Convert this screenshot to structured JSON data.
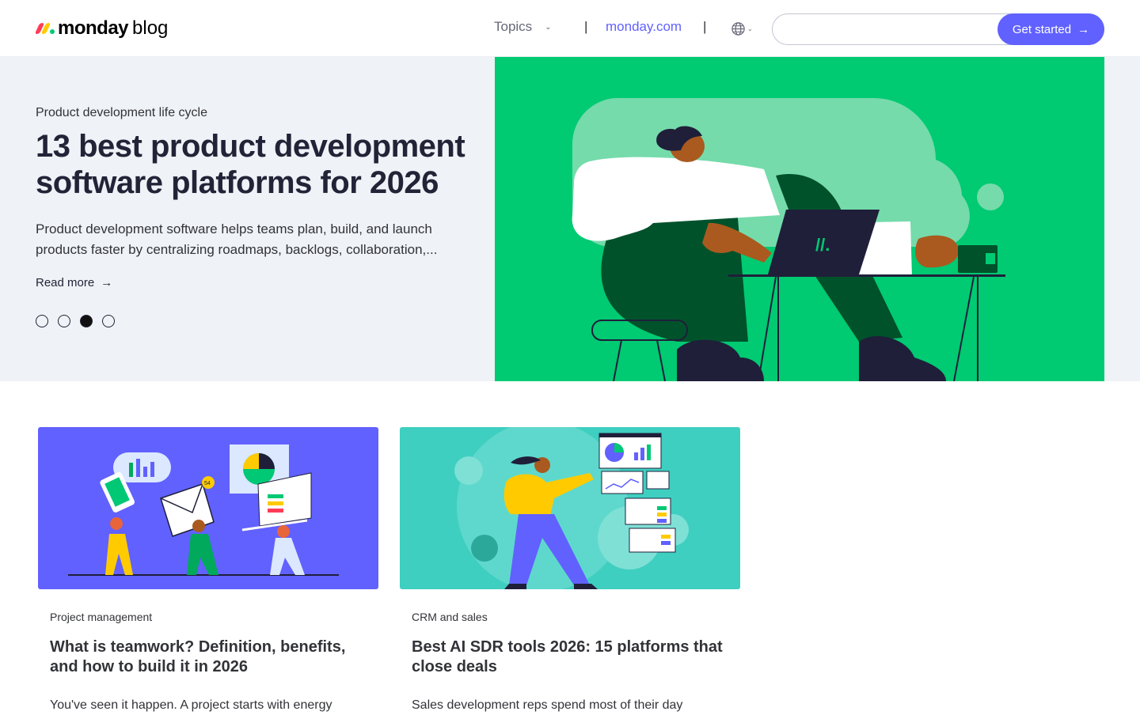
{
  "header": {
    "logo_word": "monday",
    "logo_suffix": "blog",
    "topics_label": "Topics",
    "separator": "|",
    "site_link": "monday.com",
    "search_placeholder": "",
    "cta_label": "Get started"
  },
  "hero": {
    "topic": "Product development life cycle",
    "title": "13 best product development software platforms for 2026",
    "description": "Product development software helps teams plan, build, and launch products faster by centralizing roadmaps, backlogs, collaboration,...",
    "read_more": "Read more",
    "slides_count": 4,
    "active_slide": 3
  },
  "cards": [
    {
      "topic": "Project management",
      "title": "What is teamwork? Definition, benefits, and how to build it in 2026",
      "excerpt": "You've seen it happen. A project starts with energy"
    },
    {
      "topic": "CRM and sales",
      "title": "Best AI SDR tools 2026: 15 platforms that close deals",
      "excerpt": "Sales development reps spend most of their day"
    }
  ],
  "colors": {
    "brand_purple": "#6161ff",
    "hero_bg": "#eff2f6",
    "hero_image_green": "#00ca72",
    "card1_bg": "#6161ff",
    "card2_bg": "#3ecfc0",
    "logo_red": "#ff3d57",
    "logo_yellow": "#ffcb00",
    "logo_green": "#00ca72"
  },
  "icons": [
    "chevron-down-icon",
    "globe-icon",
    "arrow-right-icon"
  ]
}
